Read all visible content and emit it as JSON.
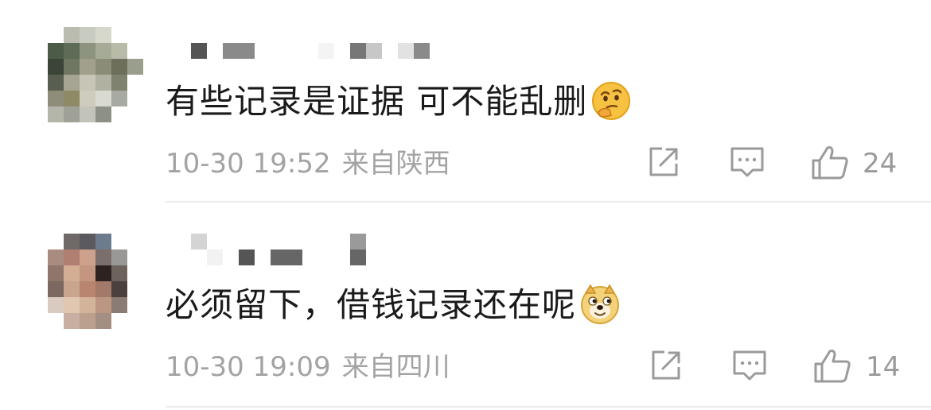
{
  "comments": [
    {
      "text": "有些记录是证据  可不能乱删",
      "emoji": "thinking-face-emoji",
      "time": "10-30 19:52",
      "location": "来自陕西",
      "likes": "24"
    },
    {
      "text": "必须留下，借钱记录还在呢",
      "emoji": "doge-emoji",
      "time": "10-30 19:09",
      "location": "来自四川",
      "likes": "14"
    }
  ],
  "icons": {
    "share": "share-icon",
    "comment": "comment-icon",
    "like": "thumbs-up-icon"
  },
  "colors": {
    "text": "#1a1a1a",
    "meta": "#a3a3a3",
    "icon": "#9a9a9a",
    "divider": "#ececec"
  }
}
